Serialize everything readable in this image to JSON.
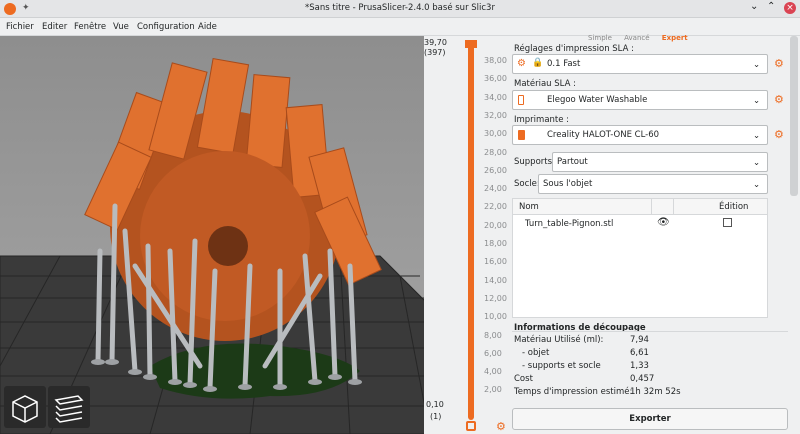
{
  "window": {
    "title": "*Sans titre - PrusaSlicer-2.4.0 basé sur Slic3r"
  },
  "menu": [
    "Fichier",
    "Editer",
    "Fenêtre",
    "Vue",
    "Configuration",
    "Aide"
  ],
  "mode_tabs": [
    "Simple",
    "Avancé",
    "Expert"
  ],
  "slider": {
    "top_value": "39,70",
    "top_layer": "(397)",
    "ticks": [
      "38,00",
      "36,00",
      "34,00",
      "32,00",
      "30,00",
      "28,00",
      "26,00",
      "24,00",
      "22,00",
      "20,00",
      "18,00",
      "16,00",
      "14,00",
      "12,00",
      "10,00",
      "8,00",
      "6,00",
      "4,00",
      "2,00"
    ],
    "bottom_value": "0,10",
    "bottom_layer": "(1)"
  },
  "panel": {
    "print_settings_label": "Réglages d'impression SLA :",
    "print_settings_value": "0.1 Fast",
    "material_label": "Matériau SLA :",
    "material_value": "Elegoo Water Washable",
    "printer_label": "Imprimante :",
    "printer_value": "Creality HALOT-ONE CL-60",
    "supports_label": "Supports:",
    "supports_value": "Partout",
    "pad_label": "Socle:",
    "pad_value": "Sous l'objet",
    "object_list": {
      "col_name": "Nom",
      "col_edit": "Édition",
      "rows": [
        {
          "name": "Turn_table-Pignon.stl"
        }
      ]
    },
    "slice_info": {
      "title": "Informations de découpage",
      "rows": [
        {
          "label": "Matériau Utilisé (ml):",
          "value": "7,94"
        },
        {
          "label": "- objet",
          "value": "6,61"
        },
        {
          "label": "- supports et socle",
          "value": "1,33"
        },
        {
          "label": "Cost",
          "value": "0,457"
        },
        {
          "label": "Temps d'impression estimé:",
          "value": "1h 32m 52s"
        }
      ]
    },
    "export_label": "Exporter"
  },
  "colors": {
    "accent": "#ed6b21",
    "part": "#d9692c",
    "support": "#b9bcbf",
    "pad": "#1c3a17"
  }
}
